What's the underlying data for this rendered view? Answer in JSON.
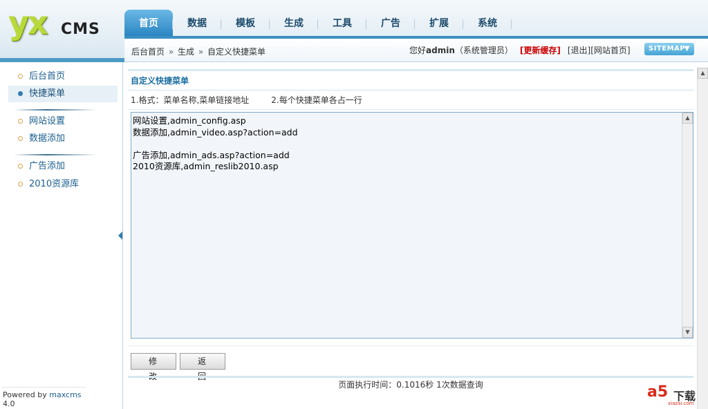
{
  "logo": {
    "mark": "yx",
    "text": "CMS"
  },
  "nav": {
    "items": [
      "首页",
      "数据",
      "模板",
      "生成",
      "工具",
      "广告",
      "扩展",
      "系统"
    ],
    "active_index": 0
  },
  "breadcrumb": {
    "home": "后台首页",
    "sep": "»",
    "section": "生成",
    "page": "自定义快捷菜单"
  },
  "userbar": {
    "greeting": "您好",
    "user": "admin",
    "role": "（系统管理员）",
    "refresh": "[更新缓存]",
    "logout": "[退出]",
    "site_home": "[网站首页]",
    "sitemap": "SITEMAP"
  },
  "sidebar": {
    "items": [
      {
        "label": "后台首页",
        "active": false
      },
      {
        "label": "快捷菜单",
        "active": true
      },
      {
        "label": "网站设置",
        "active": false
      },
      {
        "label": "数据添加",
        "active": false
      },
      {
        "label": "广告添加",
        "active": false
      },
      {
        "label": "2010资源库",
        "active": false
      }
    ],
    "powered_prefix": "Powered by ",
    "powered_brand": "maxcms",
    "powered_version": " 4.0"
  },
  "main": {
    "title": "自定义快捷菜单",
    "format_1": "1.格式：菜单名称,菜单链接地址",
    "format_2": "2.每个快捷菜单各占一行",
    "editor_value": "网站设置,admin_config.asp\n数据添加,admin_video.asp?action=add\n\n广告添加,admin_ads.asp?action=add\n2010资源库,admin_reslib2010.asp",
    "modify_button": "修 改",
    "back_button": "返 回",
    "exec_time": "页面执行时间：0.1016秒 1次数据查询"
  },
  "watermark": {
    "mark": "a5",
    "text": "下载",
    "sub": "xiazai.com"
  },
  "colors": {
    "accent": "#2b86c2",
    "link": "#1b5f8e",
    "refresh": "#cc0000"
  }
}
